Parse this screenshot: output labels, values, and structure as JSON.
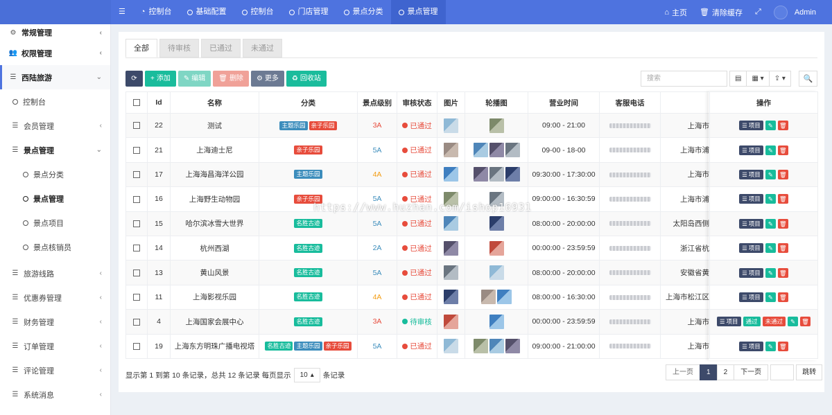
{
  "topbar": {
    "nav": [
      {
        "label": "",
        "icon": "menu-icon"
      },
      {
        "label": "控制台",
        "icon": "dashboard-icon"
      },
      {
        "label": "基础配置",
        "icon": "circle-icon"
      },
      {
        "label": "控制台",
        "icon": "circle-icon"
      },
      {
        "label": "门店管理",
        "icon": "circle-icon"
      },
      {
        "label": "景点分类",
        "icon": "circle-icon"
      },
      {
        "label": "景点管理",
        "icon": "circle-icon",
        "active": true
      }
    ],
    "home_label": "主页",
    "clear_cache_label": "清除缓存",
    "user_name": "Admin"
  },
  "sidebar": {
    "items": [
      {
        "label": "常规管理"
      },
      {
        "label": "权限管理"
      },
      {
        "label": "西陆旅游"
      },
      {
        "label": "控制台"
      },
      {
        "label": "会员管理"
      },
      {
        "label": "景点管理"
      },
      {
        "label": "景点分类"
      },
      {
        "label": "景点管理"
      },
      {
        "label": "景点项目"
      },
      {
        "label": "景点核销员"
      },
      {
        "label": "旅游线路"
      },
      {
        "label": "优惠券管理"
      },
      {
        "label": "财务管理"
      },
      {
        "label": "订单管理"
      },
      {
        "label": "评论管理"
      },
      {
        "label": "系统消息"
      }
    ]
  },
  "tabs": [
    "全部",
    "待审核",
    "已通过",
    "未通过"
  ],
  "toolbar": {
    "add": "添加",
    "edit": "编辑",
    "delete": "删除",
    "more": "更多",
    "recycle": "回收站",
    "search_placeholder": "搜索"
  },
  "table": {
    "headers": [
      "Id",
      "名称",
      "分类",
      "景点级别",
      "审核状态",
      "图片",
      "轮播图",
      "营业时间",
      "客服电话",
      "",
      "操作"
    ],
    "rows": [
      {
        "id": "22",
        "name": "测试",
        "tags": [
          [
            "主题乐园",
            "blue"
          ],
          [
            "亲子乐园",
            "red"
          ]
        ],
        "level": "3A",
        "status": "已通过",
        "status_color": "red",
        "imgs": 1,
        "carousel": 1,
        "hours": "09:00 - 21:00",
        "addr": "上海市",
        "ops": "normal"
      },
      {
        "id": "21",
        "name": "上海迪士尼",
        "tags": [
          [
            "亲子乐园",
            "red"
          ]
        ],
        "level": "5A",
        "status": "已通过",
        "status_color": "red",
        "imgs": 1,
        "carousel": 3,
        "hours": "09-00 - 18-00",
        "addr": "上海市浦",
        "ops": "normal"
      },
      {
        "id": "17",
        "name": "上海海昌海洋公园",
        "tags": [
          [
            "主题乐园",
            "blue"
          ]
        ],
        "level": "4A",
        "status": "已通过",
        "status_color": "red",
        "imgs": 1,
        "carousel": 3,
        "hours": "09:30:00 - 17:30:00",
        "addr": "上海市",
        "ops": "normal"
      },
      {
        "id": "16",
        "name": "上海野生动物园",
        "tags": [
          [
            "亲子乐园",
            "red"
          ]
        ],
        "level": "5A",
        "status": "已通过",
        "status_color": "red",
        "imgs": 1,
        "carousel": 1,
        "hours": "09:00:00 - 16:30:59",
        "addr": "上海市浦",
        "ops": "normal"
      },
      {
        "id": "15",
        "name": "哈尔滨冰雪大世界",
        "tags": [
          [
            "名胜古迹",
            "green"
          ]
        ],
        "level": "5A",
        "status": "已通过",
        "status_color": "red",
        "imgs": 1,
        "carousel": 1,
        "hours": "08:00:00 - 20:00:00",
        "addr": "太阳岛西侧",
        "ops": "normal"
      },
      {
        "id": "14",
        "name": "杭州西湖",
        "tags": [
          [
            "名胜古迹",
            "green"
          ]
        ],
        "level": "2A",
        "status": "已通过",
        "status_color": "red",
        "imgs": 1,
        "carousel": 1,
        "hours": "00:00:00 - 23:59:59",
        "addr": "浙江省杭",
        "ops": "normal"
      },
      {
        "id": "13",
        "name": "黄山风景",
        "tags": [
          [
            "名胜古迹",
            "green"
          ]
        ],
        "level": "5A",
        "status": "已通过",
        "status_color": "red",
        "imgs": 1,
        "carousel": 1,
        "hours": "08:00:00 - 20:00:00",
        "addr": "安徽省黄",
        "ops": "normal"
      },
      {
        "id": "11",
        "name": "上海影视乐园",
        "tags": [
          [
            "名胜古迹",
            "green"
          ]
        ],
        "level": "4A",
        "status": "已通过",
        "status_color": "red",
        "imgs": 1,
        "carousel": 2,
        "hours": "08:00:00 - 16:30:00",
        "addr": "上海市松江区",
        "ops": "normal"
      },
      {
        "id": "4",
        "name": "上海国家会展中心",
        "tags": [
          [
            "名胜古迹",
            "green"
          ]
        ],
        "level": "3A",
        "status": "待审核",
        "status_color": "green",
        "imgs": 1,
        "carousel": 1,
        "hours": "00:00:00 - 23:59:59",
        "addr": "上海市",
        "ops": "review"
      },
      {
        "id": "19",
        "name": "上海东方明珠广播电视塔",
        "tags": [
          [
            "名胜古迹",
            "green"
          ],
          [
            "主题乐园",
            "blue"
          ],
          [
            "亲子乐园",
            "red"
          ]
        ],
        "level": "5A",
        "status": "已通过",
        "status_color": "red",
        "imgs": 1,
        "carousel": 3,
        "hours": "09:00:00 - 21:00:00",
        "addr": "上海市",
        "ops": "normal"
      }
    ],
    "op_project": "项目",
    "op_pass": "通过",
    "op_reject": "未通过"
  },
  "footer": {
    "info": "显示第 1 到第 10 条记录，总共 12 条记录 每页显示",
    "per_page": "10",
    "suffix": "条记录",
    "prev": "上一页",
    "pages": [
      "1",
      "2"
    ],
    "next": "下一页",
    "go": "跳转"
  },
  "watermark": "https://www.huzhan.com/ishop16931",
  "colors": {
    "topbar": "#4e73df",
    "accent": "#1abc9c",
    "danger": "#e74c3c",
    "dark": "#3d4a6a"
  }
}
